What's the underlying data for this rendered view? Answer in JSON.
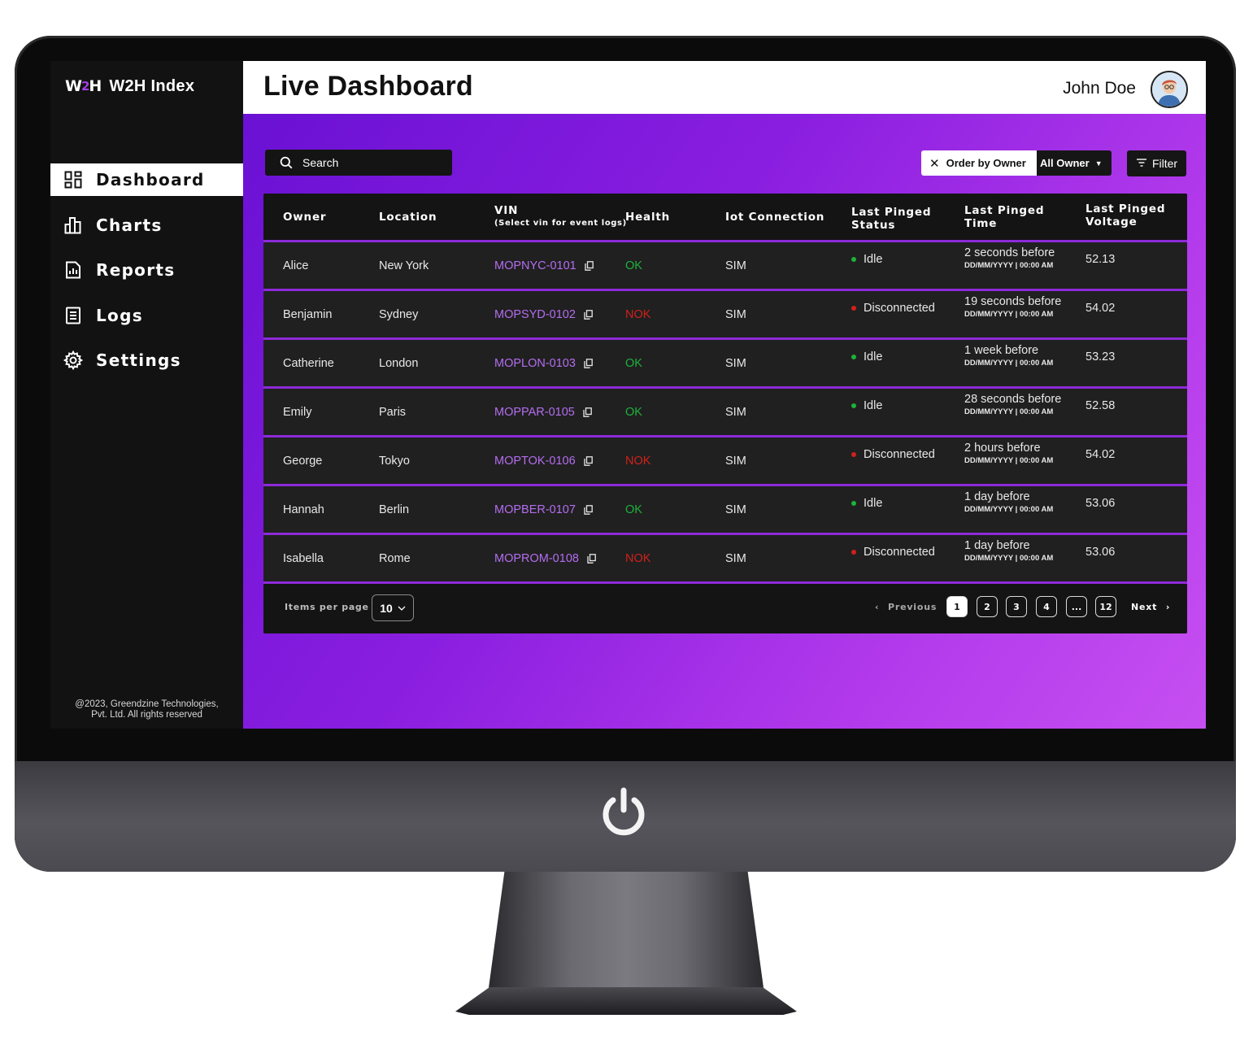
{
  "brand": {
    "logo_text": "W2H",
    "name": "W2H Index"
  },
  "sidebar": {
    "items": [
      {
        "label": "Dashboard",
        "icon": "dashboard-icon",
        "active": true
      },
      {
        "label": "Charts",
        "icon": "bar-chart-icon",
        "active": false
      },
      {
        "label": "Reports",
        "icon": "report-icon",
        "active": false
      },
      {
        "label": "Logs",
        "icon": "logs-icon",
        "active": false
      },
      {
        "label": "Settings",
        "icon": "gear-icon",
        "active": false
      }
    ],
    "footer_line1": "@2023, Greendzine Technologies,",
    "footer_line2": "Pvt. Ltd. All rights reserved"
  },
  "header": {
    "title": "Live Dashboard",
    "user_name": "John Doe"
  },
  "toolbar": {
    "search_label": "Search",
    "order_chip": "Order by Owner",
    "owner_select": "All Owner",
    "filter_label": "Filter"
  },
  "table": {
    "headers": {
      "owner": "Owner",
      "location": "Location",
      "vin": "VIN",
      "vin_sub": "(Select vin for event logs)",
      "health": "Health",
      "iot": "Iot Connection",
      "status_1": "Last Pinged",
      "status_2": "Status",
      "time_1": "Last Pinged",
      "time_2": "Time",
      "voltage_1": "Last Pinged",
      "voltage_2": "Voltage"
    },
    "rows": [
      {
        "owner": "Alice",
        "location": "New York",
        "vin": "MOPNYC-0101",
        "health": "OK",
        "iot": "SIM",
        "status": "Idle",
        "time": "2 seconds before",
        "time_fmt": "DD/MM/YYYY | 00:00 AM",
        "voltage": "52.13"
      },
      {
        "owner": "Benjamin",
        "location": "Sydney",
        "vin": "MOPSYD-0102",
        "health": "NOK",
        "iot": "SIM",
        "status": "Disconnected",
        "time": "19 seconds before",
        "time_fmt": "DD/MM/YYYY | 00:00 AM",
        "voltage": "54.02"
      },
      {
        "owner": "Catherine",
        "location": "London",
        "vin": "MOPLON-0103",
        "health": "OK",
        "iot": "SIM",
        "status": "Idle",
        "time": "1 week before",
        "time_fmt": "DD/MM/YYYY | 00:00 AM",
        "voltage": "53.23"
      },
      {
        "owner": "Emily",
        "location": "Paris",
        "vin": "MOPPAR-0105",
        "health": "OK",
        "iot": "SIM",
        "status": "Idle",
        "time": "28 seconds before",
        "time_fmt": "DD/MM/YYYY | 00:00 AM",
        "voltage": "52.58"
      },
      {
        "owner": "George",
        "location": "Tokyo",
        "vin": "MOPTOK-0106",
        "health": "NOK",
        "iot": "SIM",
        "status": "Disconnected",
        "time": "2 hours before",
        "time_fmt": "DD/MM/YYYY | 00:00 AM",
        "voltage": "54.02"
      },
      {
        "owner": "Hannah",
        "location": "Berlin",
        "vin": "MOPBER-0107",
        "health": "OK",
        "iot": "SIM",
        "status": "Idle",
        "time": "1 day before",
        "time_fmt": "DD/MM/YYYY | 00:00 AM",
        "voltage": "53.06"
      },
      {
        "owner": "Isabella",
        "location": "Rome",
        "vin": "MOPROM-0108",
        "health": "NOK",
        "iot": "SIM",
        "status": "Disconnected",
        "time": "1 day before",
        "time_fmt": "DD/MM/YYYY | 00:00 AM",
        "voltage": "53.06"
      }
    ]
  },
  "pagination": {
    "items_per_page_label": "Items per page",
    "items_per_page": "10",
    "previous": "Previous",
    "next": "Next",
    "pages": [
      "1",
      "2",
      "3",
      "4",
      "...",
      "12"
    ],
    "current": "1"
  },
  "colors": {
    "accent": "#8d2ad8",
    "ok": "#1db23c",
    "nok": "#d0211b",
    "vin_link": "#b46df0"
  }
}
